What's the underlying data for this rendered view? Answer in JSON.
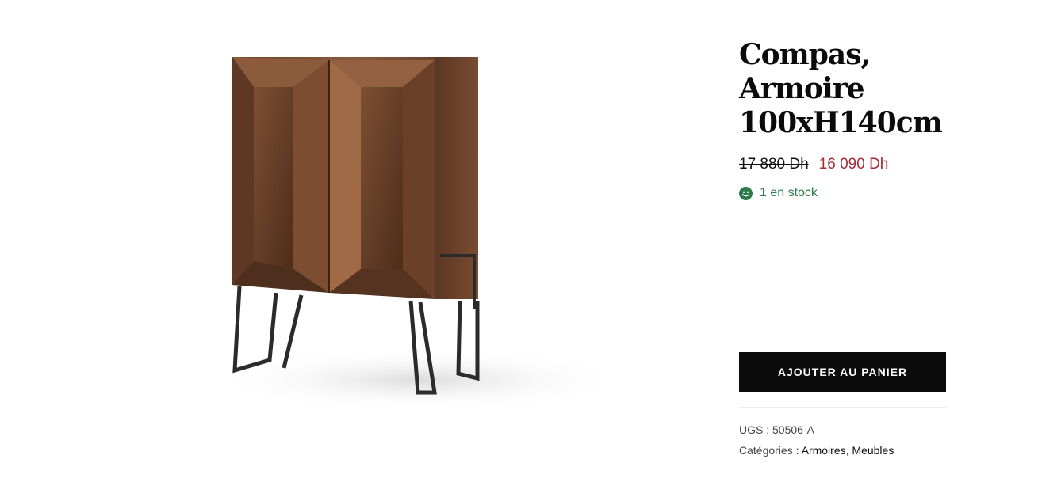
{
  "product": {
    "title": "Compas, Armoire 100xH140cm",
    "price_old": "17 880 Dh",
    "price_new": "16 090 Dh",
    "stock": "1 en stock",
    "stock_icon": "smiley-icon",
    "add_to_cart_label": "AJOUTER AU PANIER",
    "sku_label": "UGS :",
    "sku_value": "50506-A",
    "categories_label": "Catégories :",
    "categories": [
      "Armoires",
      "Meubles"
    ],
    "categories_separator": ","
  },
  "colors": {
    "sale_price": "#a52a36",
    "in_stock": "#2b7a4b",
    "button_bg": "#0b0b0b",
    "wood": "#6b4029"
  }
}
